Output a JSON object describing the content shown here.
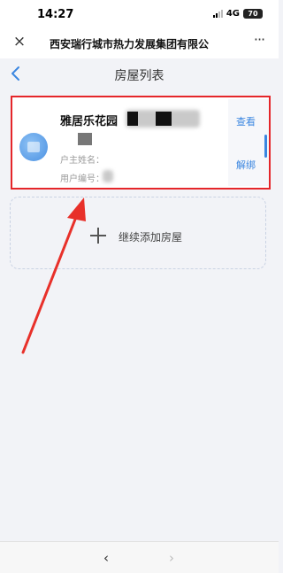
{
  "status_bar": {
    "time": "14:27",
    "network": "4G",
    "battery": "70"
  },
  "mini_header": {
    "title": "西安瑞行城市热力发展集团有限公",
    "close_icon": "×",
    "more_icon": "···"
  },
  "nav": {
    "title": "房屋列表",
    "back_icon": "chevron-left"
  },
  "house_card": {
    "community_name": "雅居乐花园",
    "owner_label": "户主姓名：",
    "user_no_label": "用户编号：",
    "view_label": "查看",
    "unbind_label": "解绑"
  },
  "add_house": {
    "label": "继续添加房屋"
  },
  "bottom_bar": {
    "prev_icon": "‹",
    "next_icon": "›"
  },
  "colors": {
    "accent": "#3a86e0",
    "highlight_box": "#e5262a",
    "background": "#f2f3f7"
  }
}
